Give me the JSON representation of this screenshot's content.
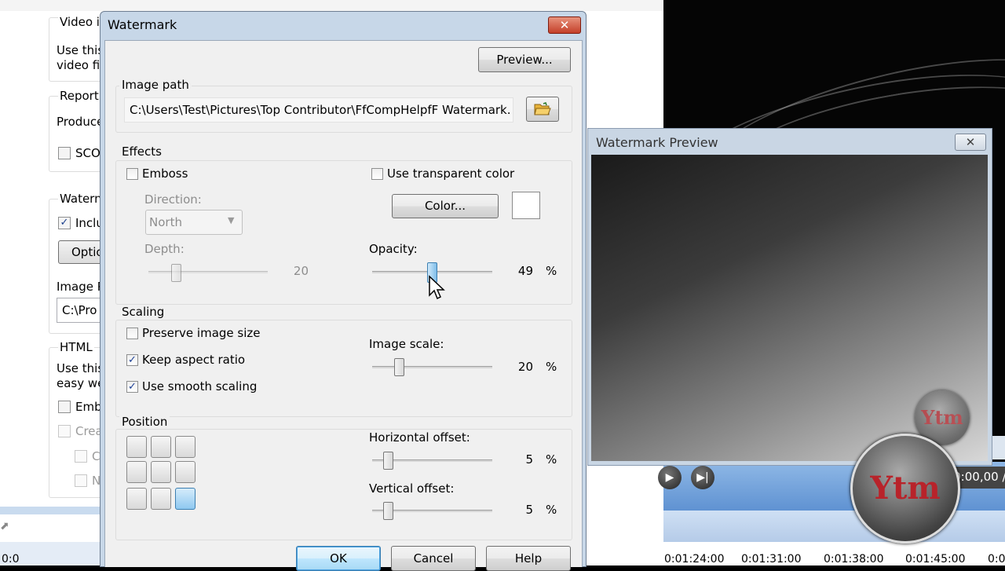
{
  "background_window": {
    "video_group_label": "Video i",
    "video_text_1": "Use this",
    "video_text_2": "video fil",
    "report_group_label": "Reporti",
    "report_text": "Produce",
    "scorm_checkbox_label": "SCO",
    "watermark_group_label": "Watern",
    "include_checkbox_label": "Inclu",
    "include_checked": true,
    "options_button_label": "Optio",
    "image_path_label": "Image P",
    "image_path_value": "C:\\Pro",
    "html_group_label": "HTML",
    "html_text_1": "Use this",
    "html_text_2": "easy we",
    "embed_checkbox_label": "Emb",
    "create_checkbox_label": "Crea",
    "sub_checkbox_1_label": "C",
    "sub_checkbox_2_label": "N",
    "left_tick_label": "0:0"
  },
  "player": {
    "time_display": "0:00:00,00 /",
    "timeline_ticks": [
      "0:01:24:00",
      "0:01:31:00",
      "0:01:38:00",
      "0:01:45:00",
      "0:0"
    ]
  },
  "preview_window": {
    "title": "Watermark Preview",
    "close_label": "✕",
    "logo_text": "Ytm"
  },
  "logo_overlay_text": "Ytm",
  "dialog": {
    "title": "Watermark",
    "close_label": "✕",
    "preview_button": "Preview...",
    "image_path": {
      "group_label": "Image path",
      "value": "C:\\Users\\Test\\Pictures\\Top Contributor\\FfCompHelpfF Watermark.",
      "browse_icon": "folder-open-icon"
    },
    "effects": {
      "group_label": "Effects",
      "emboss_label": "Emboss",
      "emboss_checked": false,
      "direction_label": "Direction:",
      "direction_value": "North",
      "depth_label": "Depth:",
      "depth_value": "20",
      "depth_level": 0.2,
      "transparent_label": "Use transparent color",
      "transparent_checked": false,
      "color_button": "Color...",
      "color_swatch": "#ffffff",
      "opacity_label": "Opacity:",
      "opacity_value": "49",
      "opacity_unit": "%",
      "opacity_level": 0.49
    },
    "scaling": {
      "group_label": "Scaling",
      "preserve_label": "Preserve image size",
      "preserve_checked": false,
      "keep_aspect_label": "Keep aspect ratio",
      "keep_aspect_checked": true,
      "smooth_label": "Use smooth scaling",
      "smooth_checked": true,
      "image_scale_label": "Image scale:",
      "image_scale_value": "20",
      "image_scale_unit": "%",
      "image_scale_level": 0.2
    },
    "position": {
      "group_label": "Position",
      "selected_cell": "bottom-right",
      "h_offset_label": "Horizontal offset:",
      "h_offset_value": "5",
      "h_offset_unit": "%",
      "h_offset_level": 0.05,
      "v_offset_label": "Vertical offset:",
      "v_offset_value": "5",
      "v_offset_unit": "%",
      "v_offset_level": 0.05
    },
    "ok_button": "OK",
    "cancel_button": "Cancel",
    "help_button": "Help"
  },
  "colors": {
    "dialog_frame": "#c7d7e8",
    "client_bg": "#f0f0f0",
    "player_bar": "#6f9fd8",
    "close_red": "#c4402a"
  }
}
